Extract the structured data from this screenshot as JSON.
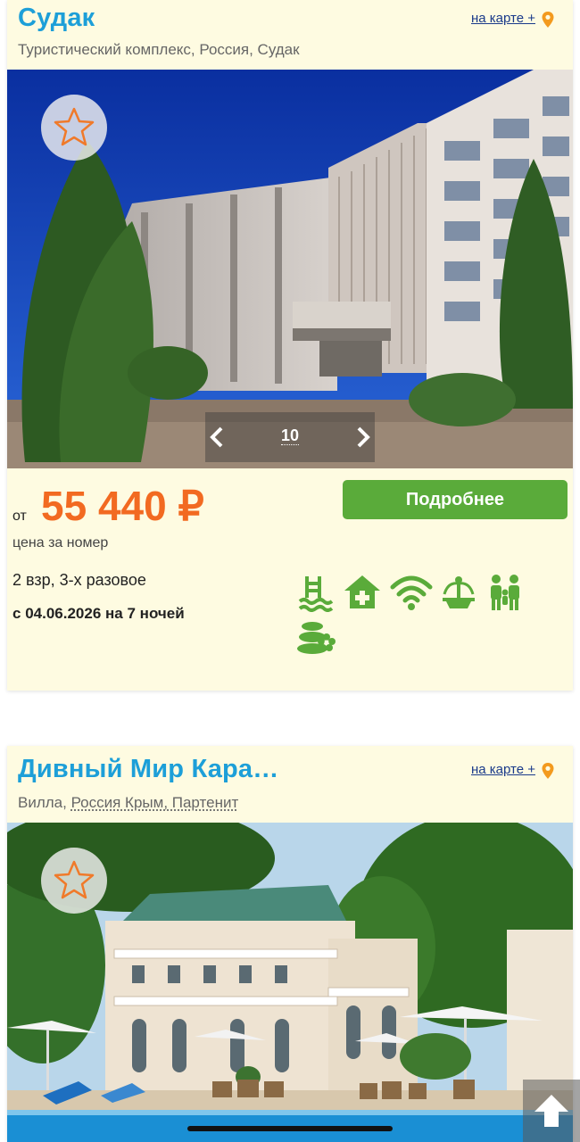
{
  "hotels": [
    {
      "title": "Судак",
      "map_link": "на карте +",
      "subtitle": "Туристический комплекс, Россия, Судак",
      "gallery_count": "10",
      "price_prefix": "от",
      "price": "55 440 ₽",
      "price_note": "цена за номер",
      "details_button": "Подробнее",
      "guests_meal": "2 взр, 3-х разовое",
      "dates_prefix": "с",
      "date": "04.06.2026",
      "dates_mid": "на",
      "nights": "7 ночей",
      "amenities": [
        "pool-icon",
        "medical-center-icon",
        "wifi-icon",
        "fountain-icon",
        "family-icon",
        "spa-icon"
      ]
    },
    {
      "title": "Дивный Мир Кара…",
      "map_link": "на карте +",
      "subtitle_type": "Вилла, ",
      "subtitle_location": "Россия Крым, Партенит"
    }
  ],
  "colors": {
    "card_bg": "#fefbe1",
    "title": "#1d9fd8",
    "price": "#f26a21",
    "button": "#5aab3a",
    "amenity": "#5aab3a",
    "pin": "#f39a1e"
  }
}
